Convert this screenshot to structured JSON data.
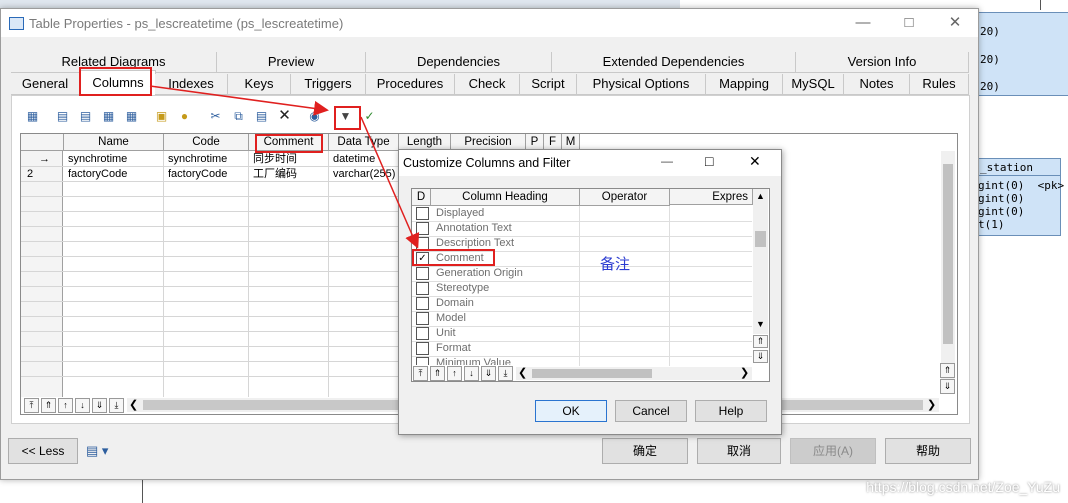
{
  "window": {
    "title": "Table Properties - ps_lescreatetime (ps_lescreatetime)"
  },
  "tabs_row1": [
    "Related Diagrams",
    "Preview",
    "Dependencies",
    "Extended Dependencies",
    "Version Info"
  ],
  "tabs_row2": [
    "General",
    "Columns",
    "Indexes",
    "Keys",
    "Triggers",
    "Procedures",
    "Check",
    "Script",
    "Physical Options",
    "Mapping",
    "MySQL",
    "Notes",
    "Rules"
  ],
  "active_tab": "Columns",
  "grid": {
    "headers": [
      "Name",
      "Code",
      "Comment",
      "Data Type",
      "Length",
      "Precision",
      "P",
      "F",
      "M"
    ],
    "rows": [
      {
        "num": "→",
        "name": "synchrotime",
        "code": "synchrotime",
        "comment": "同步时间",
        "datatype": "datetime"
      },
      {
        "num": "2",
        "name": "factoryCode",
        "code": "factoryCode",
        "comment": "工厂编码",
        "datatype": "varchar(255)"
      }
    ]
  },
  "bottom_buttons": {
    "less": "<< Less",
    "ok": "确定",
    "cancel": "取消",
    "apply": "应用(A)",
    "help": "帮助"
  },
  "dialog": {
    "title": "Customize Columns and Filter",
    "headers": [
      "D",
      "Column Heading",
      "Operator",
      "Expres"
    ],
    "items": [
      {
        "label": "Displayed",
        "checked": false
      },
      {
        "label": "Annotation Text",
        "checked": false
      },
      {
        "label": "Description Text",
        "checked": false
      },
      {
        "label": "Comment",
        "checked": true
      },
      {
        "label": "Generation Origin",
        "checked": false
      },
      {
        "label": "Stereotype",
        "checked": false
      },
      {
        "label": "Domain",
        "checked": false
      },
      {
        "label": "Model",
        "checked": false
      },
      {
        "label": "Unit",
        "checked": false
      },
      {
        "label": "Format",
        "checked": false
      },
      {
        "label": "Minimum Value",
        "checked": false
      }
    ],
    "annotation": "备注",
    "ok": "OK",
    "cancel": "Cancel",
    "help": "Help"
  },
  "background": {
    "table1_rows": [
      "20)",
      "20)",
      "20)"
    ],
    "table2_title": "_station",
    "table2_rows": [
      "gint(0)  <pk>",
      "gint(0)",
      "gint(0)",
      "t(1)"
    ]
  },
  "watermark": "https://blog.csdn.net/Zoe_YuZu",
  "colors": {
    "annotation_red": "#e0201f",
    "annotation_blue": "#2b3bd1",
    "diagram_blue": "#cfe3f7"
  }
}
